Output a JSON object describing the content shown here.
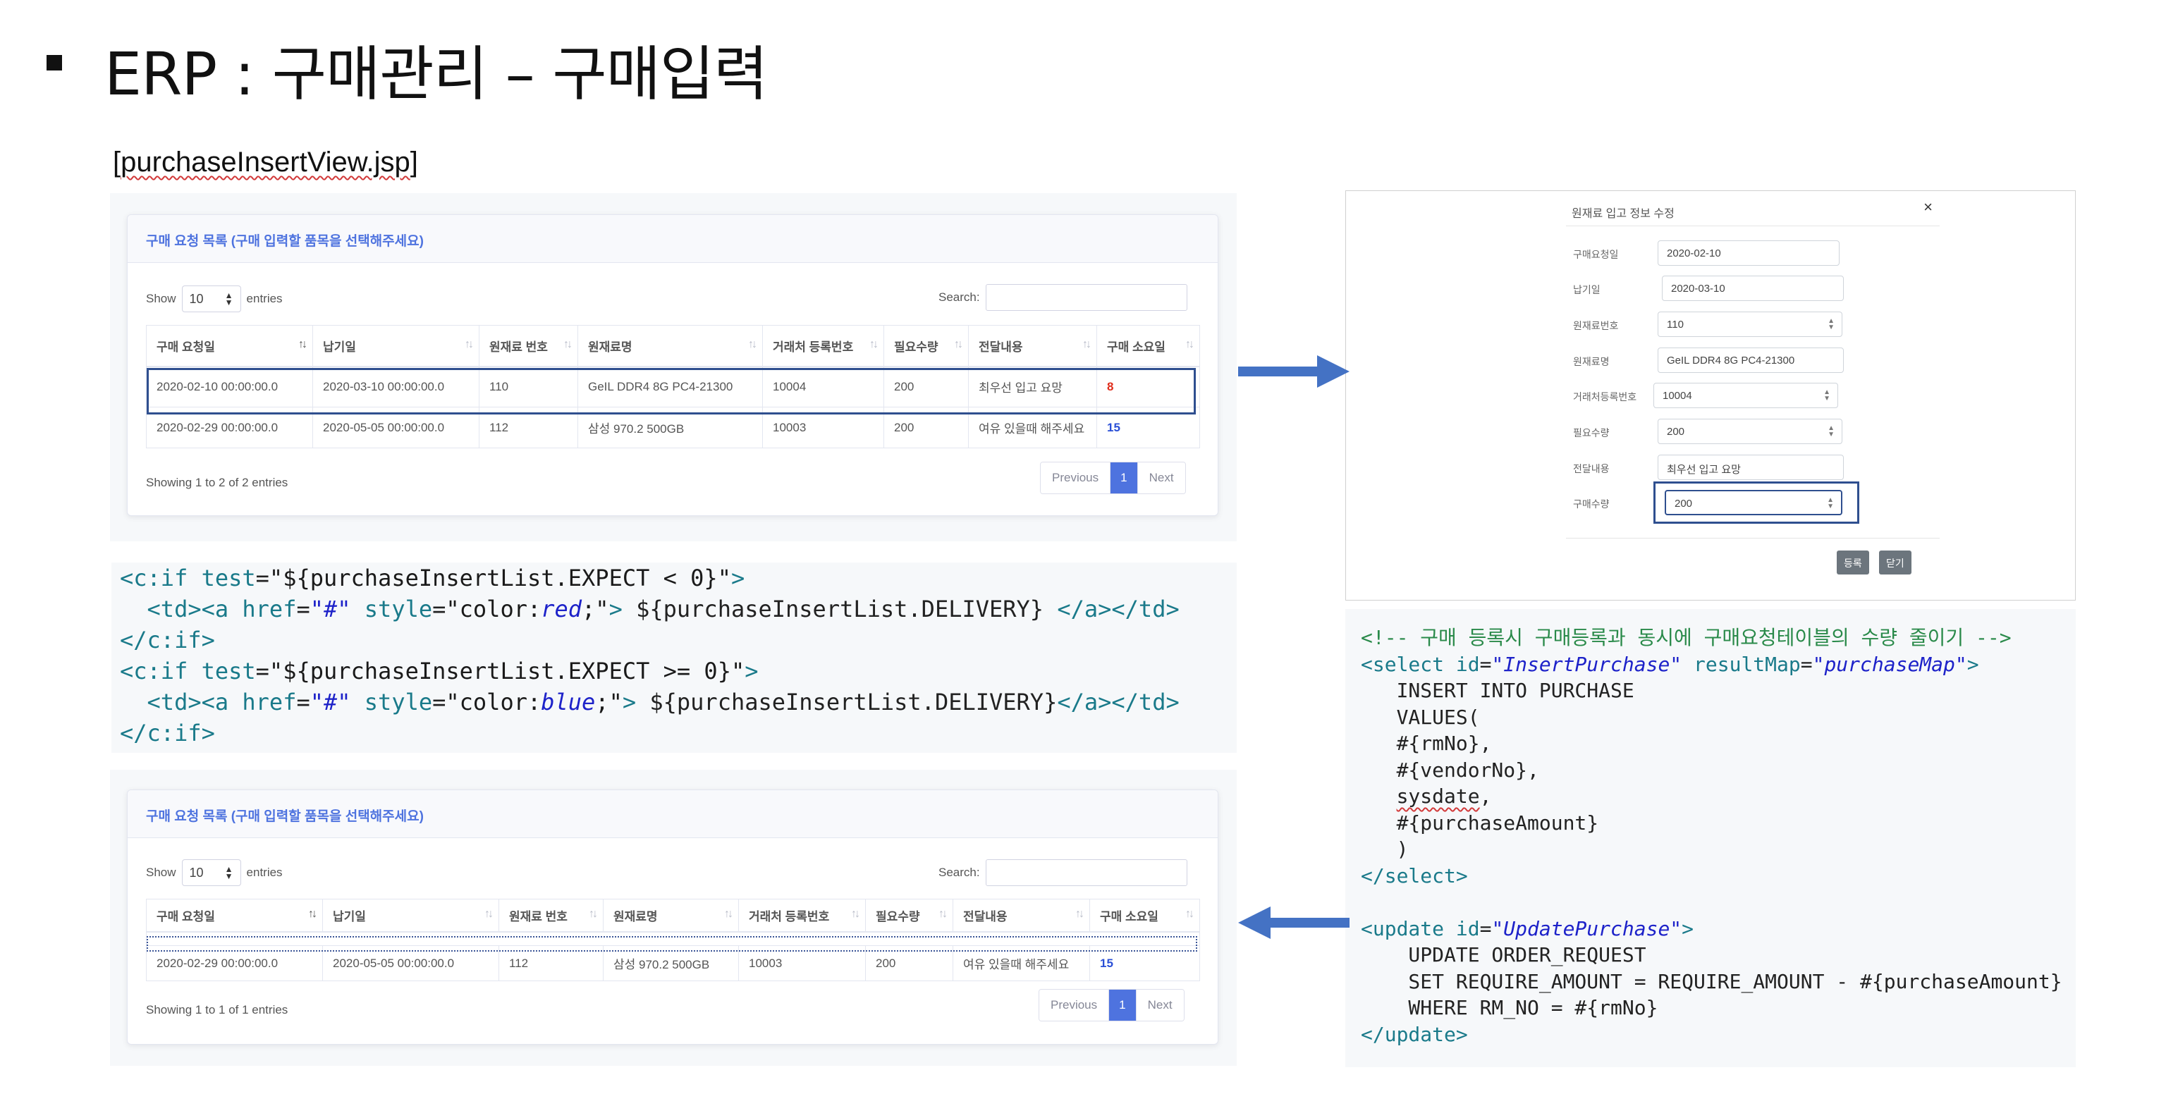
{
  "slide": {
    "title": "ERP : 구매관리 – 구매입력",
    "file_label_prefix": "[",
    "file_label_name": "purchaseInsertView.jsp",
    "file_label_suffix": "]"
  },
  "colors": {
    "primary": "#4e73df",
    "negative": "#e02d1b",
    "positive": "#2a4fd6",
    "highlight": "#2f4f8f",
    "arrow": "#4472c4"
  },
  "top_table": {
    "card_title": "구매 요청 목록 (구매 입력할 품목을 선택해주세요)",
    "show_label": "Show",
    "entries_value": "10",
    "entries_label": "entries",
    "search_label": "Search:",
    "columns": [
      "구매 요청일",
      "납기일",
      "원재료 번호",
      "원재료명",
      "거래처 등록번호",
      "필요수량",
      "전달내용",
      "구매 소요일"
    ],
    "rows": [
      [
        "2020-02-10 00:00:00.0",
        "2020-03-10 00:00:00.0",
        "110",
        "GeIL DDR4 8G PC4-21300",
        "10004",
        "200",
        "최우선 입고 요망",
        "8"
      ],
      [
        "2020-02-29 00:00:00.0",
        "2020-05-05 00:00:00.0",
        "112",
        "삼성 970.2 500GB",
        "10003",
        "200",
        "여유 있을때 해주세요",
        "15"
      ]
    ],
    "showing": "Showing 1 to 2 of 2 entries",
    "pager": {
      "prev": "Previous",
      "page": "1",
      "next": "Next"
    }
  },
  "code_jsp": {
    "l1_tag_open": "<c:if ",
    "l1_attr": "test",
    "l1_eq": "=",
    "l1_val": "\"${purchaseInsertList.EXPECT < 0}\"",
    "l1_close": ">",
    "l2_td": "  <td><a ",
    "l2_href_attr": "href",
    "l2_eq1": "=",
    "l2_href_val": "\"#\"",
    "l2_style_attr": " style",
    "l2_eq2": "=",
    "l2_style_a": "\"color:",
    "l2_style_b": "red",
    "l2_style_c": ";\"",
    "l2_gt": ">",
    "l2_expr": " ${purchaseInsertList.DELIVERY} ",
    "l2_end": "</a></td>",
    "l3": "</c:if>",
    "l4_tag_open": "<c:if ",
    "l4_attr": "test",
    "l4_eq": "=",
    "l4_val": "\"${purchaseInsertList.EXPECT >= 0}\"",
    "l4_close": ">",
    "l5_td": "  <td><a ",
    "l5_href_attr": "href",
    "l5_eq1": "=",
    "l5_href_val": "\"#\"",
    "l5_style_attr": " style",
    "l5_eq2": "=",
    "l5_style_a": "\"color:",
    "l5_style_b": "blue",
    "l5_style_c": ";\"",
    "l5_gt": ">",
    "l5_expr": " ${purchaseInsertList.DELIVERY}",
    "l5_end": "</a></td>",
    "l6": "</c:if>"
  },
  "bottom_table": {
    "card_title": "구매 요청 목록 (구매 입력할 품목을 선택해주세요)",
    "show_label": "Show",
    "entries_value": "10",
    "entries_label": "entries",
    "search_label": "Search:",
    "columns": [
      "구매 요청일",
      "납기일",
      "원재료 번호",
      "원재료명",
      "거래처 등록번호",
      "필요수량",
      "전달내용",
      "구매 소요일"
    ],
    "rows": [
      [
        "2020-02-29 00:00:00.0",
        "2020-05-05 00:00:00.0",
        "112",
        "삼성 970.2 500GB",
        "10003",
        "200",
        "여유 있을때 해주세요",
        "15"
      ]
    ],
    "showing": "Showing 1 to 1 of 1 entries",
    "pager": {
      "prev": "Previous",
      "page": "1",
      "next": "Next"
    }
  },
  "modal": {
    "title": "원재료 입고 정보 수정",
    "close": "×",
    "fields": [
      {
        "label": "구매요청일",
        "value": "2020-02-10"
      },
      {
        "label": "납기일",
        "value": "2020-03-10"
      },
      {
        "label": "원재료번호",
        "value": "110"
      },
      {
        "label": "원재료명",
        "value": "GeIL DDR4 8G PC4-21300"
      },
      {
        "label": "거래처등록번호",
        "value": "10004"
      },
      {
        "label": "필요수량",
        "value": "200"
      },
      {
        "label": "전달내용",
        "value": "최우선 입고 요망"
      },
      {
        "label": "구매수량",
        "value": "200"
      }
    ],
    "register_button": "등록",
    "close_button": "닫기"
  },
  "code_sql": {
    "comment": "<!-- 구매 등록시 구매등록과 동시에 구매요청테이블의 수량 줄이기 -->",
    "s1_tag": "<select ",
    "s1_id_attr": "id",
    "s1_eq1": "=",
    "s1_id_val": "\"InsertPurchase\"",
    "s1_rm_attr": " resultMap",
    "s1_eq2": "=",
    "s1_rm_val": "\"purchaseMap\"",
    "s1_close": ">",
    "q1": "   INSERT INTO PURCHASE",
    "q2": "   VALUES(",
    "q3": "   #{rmNo},",
    "q4": "   #{vendorNo},",
    "q5_indent": "   ",
    "q5_word": "sysdate",
    "q5_tail": ",",
    "q6": "   #{purchaseAmount}",
    "q7": "   )",
    "s1_end": "</select>",
    "u1_tag": "<update ",
    "u1_id_attr": "id",
    "u1_eq": "=",
    "u1_id_val": "\"UpdatePurchase\"",
    "u1_close": ">",
    "u2": "    UPDATE ORDER_REQUEST",
    "u3": "    SET REQUIRE_AMOUNT = REQUIRE_AMOUNT - #{purchaseAmount}",
    "u4": "    WHERE RM_NO = #{rmNo}",
    "u_end": "</update>"
  }
}
